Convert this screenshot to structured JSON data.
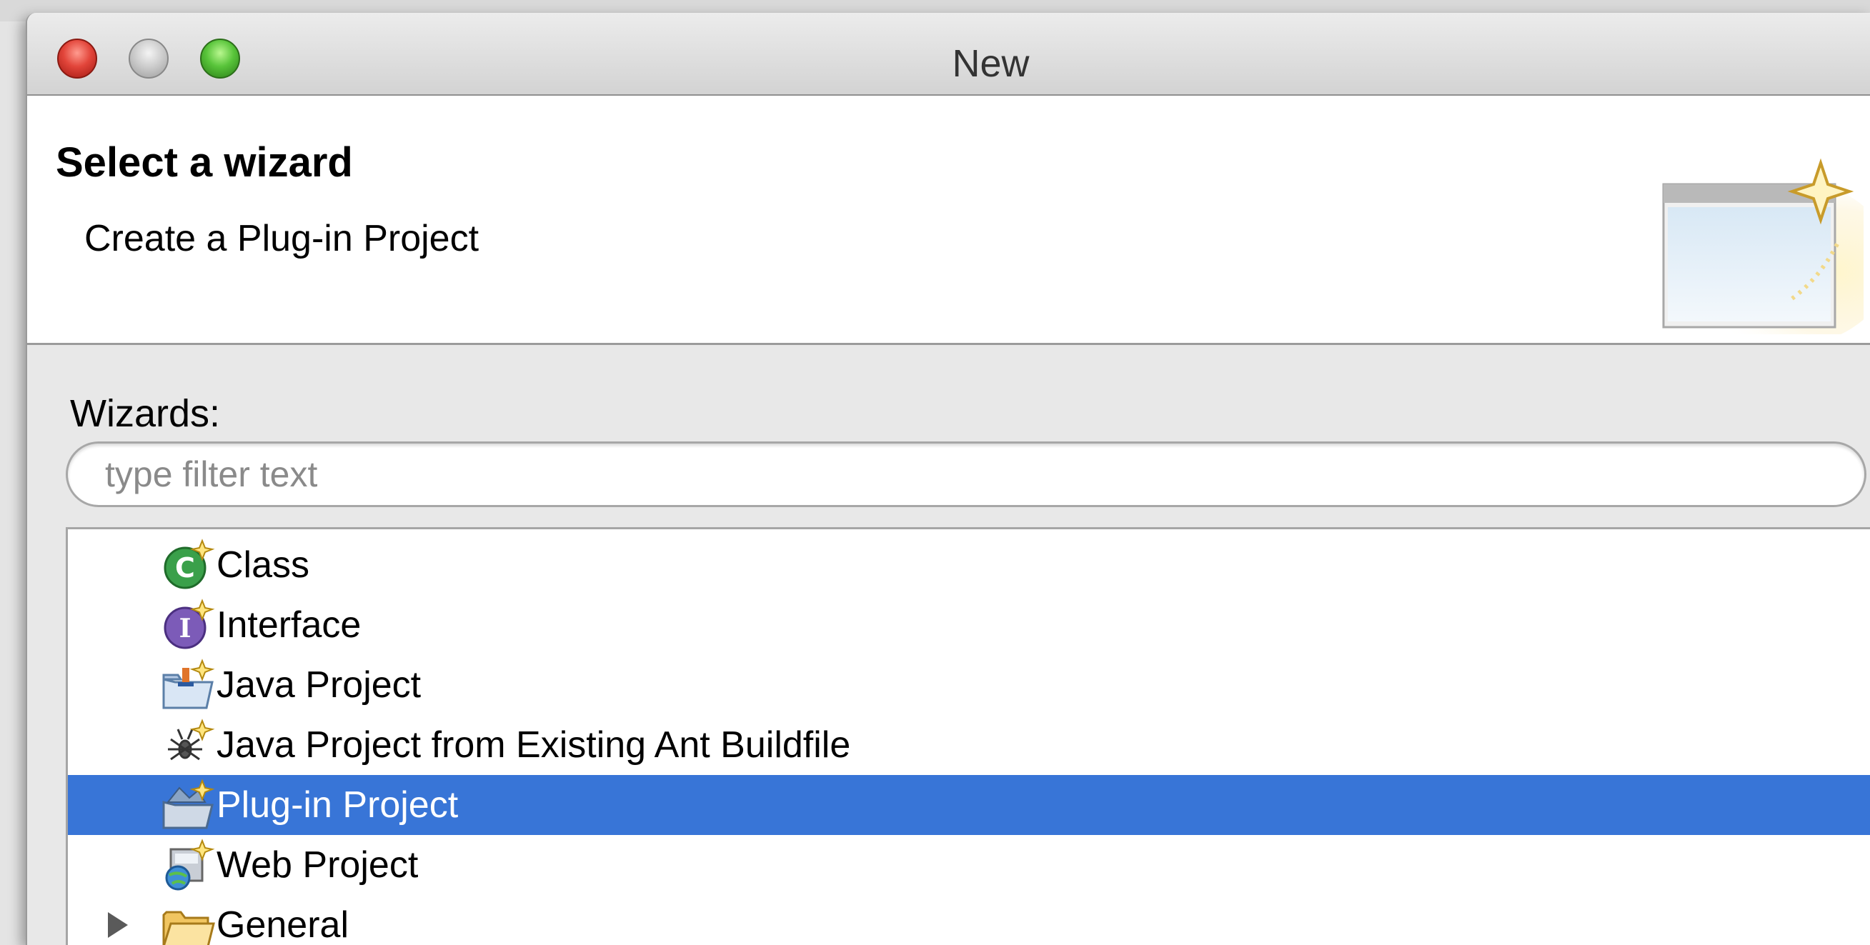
{
  "window": {
    "title": "New"
  },
  "header": {
    "title": "Select a wizard",
    "subtitle": "Create a Plug-in Project"
  },
  "wizards": {
    "label": "Wizards:",
    "filter_placeholder": "type filter text",
    "filter_value": ""
  },
  "tree": {
    "items": [
      {
        "label": "Class",
        "icon": "class-wizard-icon",
        "selected": false
      },
      {
        "label": "Interface",
        "icon": "interface-wizard-icon",
        "selected": false
      },
      {
        "label": "Java Project",
        "icon": "java-project-icon",
        "selected": false
      },
      {
        "label": "Java Project from Existing Ant Buildfile",
        "icon": "ant-buildfile-icon",
        "selected": false
      },
      {
        "label": "Plug-in Project",
        "icon": "plugin-project-icon",
        "selected": true
      },
      {
        "label": "Web Project",
        "icon": "web-project-icon",
        "selected": false
      },
      {
        "label": "General",
        "icon": "folder-icon",
        "selected": false,
        "collapsed": true
      }
    ]
  },
  "colors": {
    "selection": "#3875d7",
    "close": "#e2453a",
    "minimize": "#c9c9c9",
    "maximize": "#58c43a"
  }
}
